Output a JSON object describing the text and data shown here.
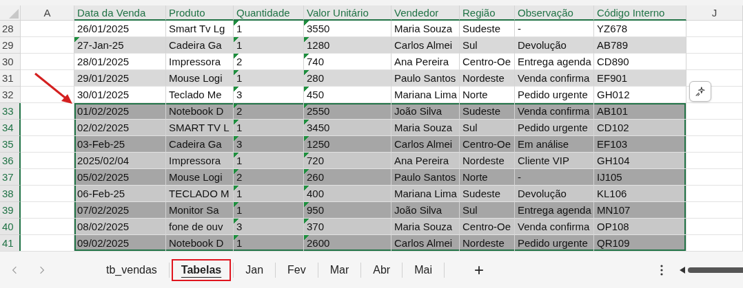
{
  "columns": [
    {
      "label": "A",
      "in_table": false
    },
    {
      "label": "Data da Venda",
      "in_table": true
    },
    {
      "label": "Produto",
      "in_table": true
    },
    {
      "label": "Quantidade",
      "in_table": true
    },
    {
      "label": "Valor Unitário",
      "in_table": true
    },
    {
      "label": "Vendedor",
      "in_table": true
    },
    {
      "label": "Região",
      "in_table": true
    },
    {
      "label": "Observação",
      "in_table": true
    },
    {
      "label": "Código Interno",
      "in_table": true
    },
    {
      "label": "J",
      "in_table": false
    }
  ],
  "rows": [
    {
      "number": "28",
      "shaded": false,
      "selected": false,
      "cells": [
        {
          "text": "26/01/2025",
          "flag": false
        },
        {
          "text": "Smart Tv Lg",
          "flag": false
        },
        {
          "text": "1",
          "flag": true
        },
        {
          "text": "3550",
          "flag": true
        },
        {
          "text": "Maria Souza",
          "flag": false
        },
        {
          "text": "Sudeste",
          "flag": false
        },
        {
          "text": "-",
          "flag": false
        },
        {
          "text": "YZ678",
          "flag": false
        }
      ]
    },
    {
      "number": "29",
      "shaded": true,
      "selected": false,
      "cells": [
        {
          "text": "27-Jan-25",
          "flag": true
        },
        {
          "text": "Cadeira Ga",
          "flag": false
        },
        {
          "text": "1",
          "flag": true
        },
        {
          "text": "1280",
          "flag": true
        },
        {
          "text": "Carlos Almei",
          "flag": false
        },
        {
          "text": "Sul",
          "flag": false
        },
        {
          "text": "Devolução",
          "flag": false
        },
        {
          "text": "AB789",
          "flag": false
        }
      ]
    },
    {
      "number": "30",
      "shaded": false,
      "selected": false,
      "cells": [
        {
          "text": "28/01/2025",
          "flag": false
        },
        {
          "text": "Impressora",
          "flag": false
        },
        {
          "text": "2",
          "flag": true
        },
        {
          "text": "740",
          "flag": true
        },
        {
          "text": "Ana Pereira",
          "flag": false
        },
        {
          "text": "Centro-Oe",
          "flag": false
        },
        {
          "text": "Entrega agenda",
          "flag": false
        },
        {
          "text": "CD890",
          "flag": false
        }
      ]
    },
    {
      "number": "31",
      "shaded": true,
      "selected": false,
      "cells": [
        {
          "text": "29/01/2025",
          "flag": false
        },
        {
          "text": "Mouse Logi",
          "flag": false
        },
        {
          "text": "1",
          "flag": true
        },
        {
          "text": "280",
          "flag": true
        },
        {
          "text": "Paulo Santos",
          "flag": false
        },
        {
          "text": "Nordeste",
          "flag": false
        },
        {
          "text": "Venda confirma",
          "flag": false
        },
        {
          "text": "EF901",
          "flag": false
        }
      ]
    },
    {
      "number": "32",
      "shaded": false,
      "selected": false,
      "cells": [
        {
          "text": "30/01/2025",
          "flag": false
        },
        {
          "text": "Teclado Me",
          "flag": false
        },
        {
          "text": "3",
          "flag": true
        },
        {
          "text": "450",
          "flag": true
        },
        {
          "text": "Mariana Lima",
          "flag": false
        },
        {
          "text": "Norte",
          "flag": false
        },
        {
          "text": "Pedido urgente",
          "flag": false
        },
        {
          "text": "GH012",
          "flag": false
        }
      ]
    },
    {
      "number": "33",
      "shaded": true,
      "selected": true,
      "cells": [
        {
          "text": "01/02/2025",
          "flag": false
        },
        {
          "text": "Notebook D",
          "flag": false
        },
        {
          "text": "2",
          "flag": true
        },
        {
          "text": "2550",
          "flag": true
        },
        {
          "text": "João Silva",
          "flag": false
        },
        {
          "text": "Sudeste",
          "flag": false
        },
        {
          "text": "Venda confirma",
          "flag": false
        },
        {
          "text": "AB101",
          "flag": false
        }
      ]
    },
    {
      "number": "34",
      "shaded": false,
      "selected": true,
      "cells": [
        {
          "text": "02/02/2025",
          "flag": false
        },
        {
          "text": "SMART TV L",
          "flag": false
        },
        {
          "text": "1",
          "flag": true
        },
        {
          "text": "3450",
          "flag": true
        },
        {
          "text": "Maria Souza",
          "flag": false
        },
        {
          "text": "Sul",
          "flag": false
        },
        {
          "text": "Pedido urgente",
          "flag": false
        },
        {
          "text": "CD102",
          "flag": false
        }
      ]
    },
    {
      "number": "35",
      "shaded": true,
      "selected": true,
      "cells": [
        {
          "text": "03-Feb-25",
          "flag": false
        },
        {
          "text": "Cadeira Ga",
          "flag": false
        },
        {
          "text": "3",
          "flag": true
        },
        {
          "text": "1250",
          "flag": true
        },
        {
          "text": "Carlos Almei",
          "flag": false
        },
        {
          "text": "Centro-Oe",
          "flag": false
        },
        {
          "text": "Em análise",
          "flag": false
        },
        {
          "text": "EF103",
          "flag": false
        }
      ]
    },
    {
      "number": "36",
      "shaded": false,
      "selected": true,
      "cells": [
        {
          "text": "2025/02/04",
          "flag": false
        },
        {
          "text": "Impressora",
          "flag": false
        },
        {
          "text": "1",
          "flag": true
        },
        {
          "text": "720",
          "flag": true
        },
        {
          "text": "Ana Pereira",
          "flag": false
        },
        {
          "text": "Nordeste",
          "flag": false
        },
        {
          "text": "Cliente VIP",
          "flag": false
        },
        {
          "text": "GH104",
          "flag": false
        }
      ]
    },
    {
      "number": "37",
      "shaded": true,
      "selected": true,
      "cells": [
        {
          "text": "05/02/2025",
          "flag": false
        },
        {
          "text": "Mouse Logi",
          "flag": false
        },
        {
          "text": "2",
          "flag": true
        },
        {
          "text": "260",
          "flag": true
        },
        {
          "text": "Paulo Santos",
          "flag": false
        },
        {
          "text": "Norte",
          "flag": false
        },
        {
          "text": "-",
          "flag": false
        },
        {
          "text": "IJ105",
          "flag": false
        }
      ]
    },
    {
      "number": "38",
      "shaded": false,
      "selected": true,
      "cells": [
        {
          "text": "06-Feb-25",
          "flag": false
        },
        {
          "text": "TECLADO M",
          "flag": false
        },
        {
          "text": "1",
          "flag": true
        },
        {
          "text": "400",
          "flag": true
        },
        {
          "text": "Mariana Lima",
          "flag": false
        },
        {
          "text": "Sudeste",
          "flag": false
        },
        {
          "text": "Devolução",
          "flag": false
        },
        {
          "text": "KL106",
          "flag": false
        }
      ]
    },
    {
      "number": "39",
      "shaded": true,
      "selected": true,
      "cells": [
        {
          "text": "07/02/2025",
          "flag": false
        },
        {
          "text": "Monitor Sa",
          "flag": false
        },
        {
          "text": "1",
          "flag": true
        },
        {
          "text": "950",
          "flag": true
        },
        {
          "text": "João Silva",
          "flag": false
        },
        {
          "text": "Sul",
          "flag": false
        },
        {
          "text": "Entrega agenda",
          "flag": false
        },
        {
          "text": "MN107",
          "flag": false
        }
      ]
    },
    {
      "number": "40",
      "shaded": false,
      "selected": true,
      "cells": [
        {
          "text": "08/02/2025",
          "flag": false
        },
        {
          "text": "fone de ouv",
          "flag": false
        },
        {
          "text": "3",
          "flag": true
        },
        {
          "text": "370",
          "flag": true
        },
        {
          "text": "Maria Souza",
          "flag": false
        },
        {
          "text": "Centro-Oe",
          "flag": false
        },
        {
          "text": "Venda confirma",
          "flag": false
        },
        {
          "text": "OP108",
          "flag": false
        }
      ]
    },
    {
      "number": "41",
      "shaded": true,
      "selected": true,
      "cells": [
        {
          "text": "09/02/2025",
          "flag": false
        },
        {
          "text": "Notebook D",
          "flag": false
        },
        {
          "text": "1",
          "flag": true
        },
        {
          "text": "2600",
          "flag": true
        },
        {
          "text": "Carlos Almei",
          "flag": false
        },
        {
          "text": "Nordeste",
          "flag": false
        },
        {
          "text": "Pedido urgente",
          "flag": false
        },
        {
          "text": "QR109",
          "flag": false
        }
      ]
    }
  ],
  "sheet_tabs": [
    {
      "label": "tb_vendas",
      "selected": false,
      "highlighted": false
    },
    {
      "label": "Tabelas",
      "selected": true,
      "highlighted": true
    },
    {
      "label": "Jan",
      "selected": false,
      "highlighted": false
    },
    {
      "label": "Fev",
      "selected": false,
      "highlighted": false
    },
    {
      "label": "Mar",
      "selected": false,
      "highlighted": false
    },
    {
      "label": "Abr",
      "selected": false,
      "highlighted": false
    },
    {
      "label": "Mai",
      "selected": false,
      "highlighted": false
    }
  ],
  "add_sheet": "+"
}
